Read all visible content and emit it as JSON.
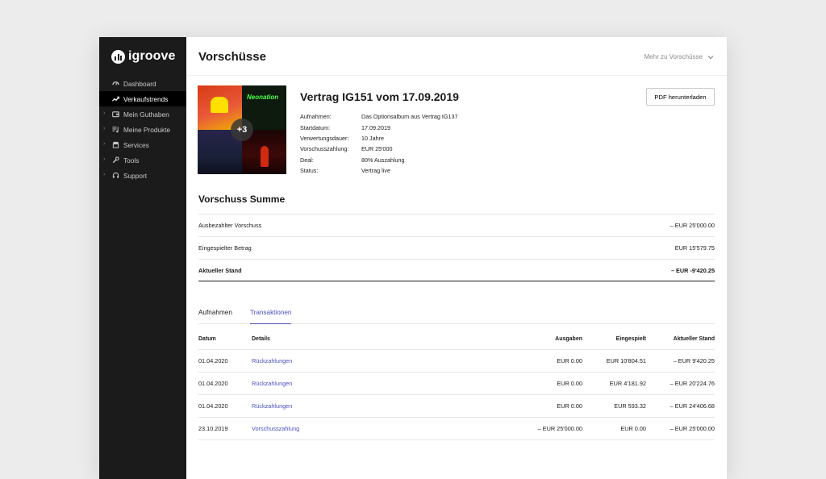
{
  "brand": {
    "name": "igroove"
  },
  "sidebar": {
    "items": [
      {
        "label": "Dashboard",
        "icon": "dashboard-icon",
        "has_chevron": false,
        "active": false
      },
      {
        "label": "Verkaufstrends",
        "icon": "trend-icon",
        "has_chevron": false,
        "active": true
      },
      {
        "label": "Mein Guthaben",
        "icon": "wallet-icon",
        "has_chevron": true,
        "active": false
      },
      {
        "label": "Meine Produkte",
        "icon": "music-list-icon",
        "has_chevron": true,
        "active": false
      },
      {
        "label": "Services",
        "icon": "store-icon",
        "has_chevron": true,
        "active": false
      },
      {
        "label": "Tools",
        "icon": "wrench-icon",
        "has_chevron": true,
        "active": false
      },
      {
        "label": "Support",
        "icon": "headset-icon",
        "has_chevron": true,
        "active": false
      }
    ]
  },
  "header": {
    "title": "Vorschüsse",
    "link_label": "Mehr zu Vorschüsse"
  },
  "contract": {
    "title_bold": "Vertrag IG151",
    "title_rest": " vom 17.09.2019",
    "cover_more": "+3",
    "cover_tags": [
      "Neonation"
    ],
    "pdf_button": "PDF herunterladen",
    "details": [
      {
        "label": "Aufnahmen:",
        "value": "Das Optionsalbum aus Vertrag IG137"
      },
      {
        "label": "Startdatum:",
        "value": "17.09.2019"
      },
      {
        "label": "Verwertungsdauer:",
        "value": "10 Jahre"
      },
      {
        "label": "Vorschusszahlung:",
        "value": "EUR 25'000"
      },
      {
        "label": "Deal:",
        "value": "80% Auszahlung"
      },
      {
        "label": "Status:",
        "value": "Vertrag live"
      }
    ]
  },
  "summary": {
    "title": "Vorschuss Summe",
    "rows": [
      {
        "label": "Ausbezahlter Vorschuss",
        "value": "– EUR 25'000.00"
      },
      {
        "label": "Eingespielter Betrag",
        "value": "EUR 15'579.75"
      },
      {
        "label": "Aktueller Stand",
        "value": "– EUR -9'420.25"
      }
    ]
  },
  "tabs": [
    {
      "label": "Aufnahmen",
      "active": false
    },
    {
      "label": "Transaktionen",
      "active": true
    }
  ],
  "table": {
    "headers": [
      "Datum",
      "Details",
      "Ausgaben",
      "Eingespielt",
      "Aktueller Stand"
    ],
    "rows": [
      [
        "01.04.2020",
        "Rückzahlungen",
        "EUR 0.00",
        "EUR 10'804.51",
        "– EUR 9'420.25"
      ],
      [
        "01.04.2020",
        "Rückzahlungen",
        "EUR 0.00",
        "EUR 4'181.92",
        "– EUR 20'224.76"
      ],
      [
        "01.04.2020",
        "Rückzahlungen",
        "EUR 0.00",
        "EUR 593.32",
        "– EUR 24'406.68"
      ],
      [
        "23.10.2019",
        "Vorschusszahlung",
        "– EUR 25'000.00",
        "EUR 0.00",
        "– EUR 25'000.00"
      ]
    ]
  },
  "colors": {
    "accent": "#4a4fbf",
    "sidebar": "#1b1b1b",
    "background": "#ececec"
  }
}
